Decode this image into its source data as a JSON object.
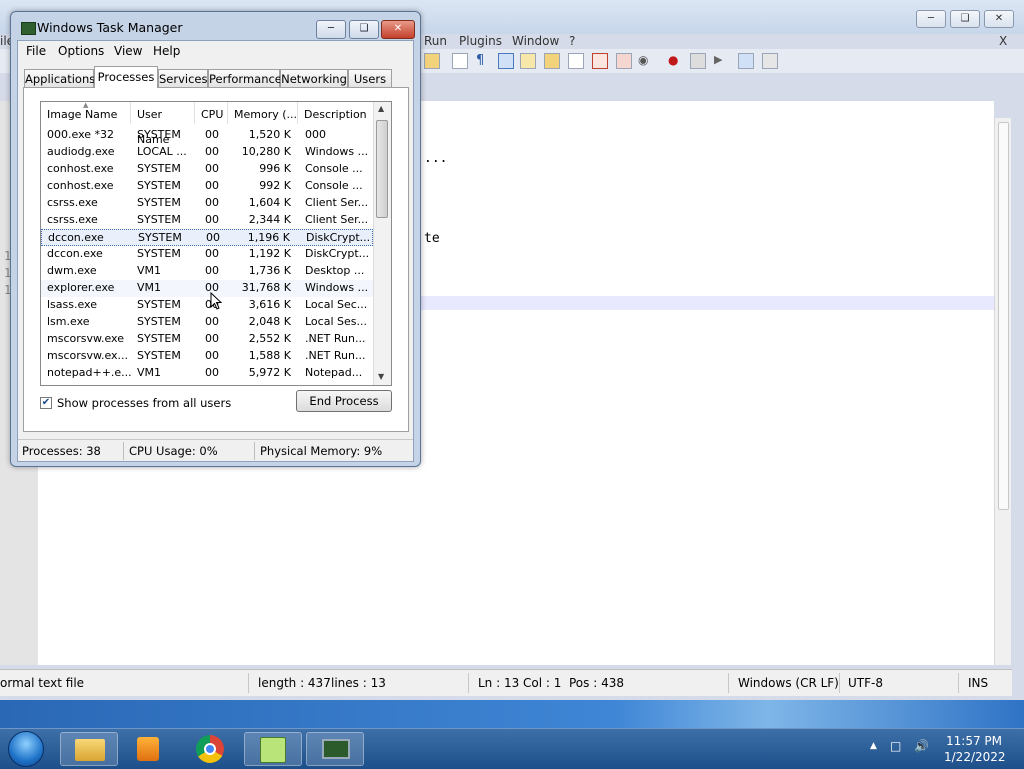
{
  "notepad": {
    "menu": [
      "ile",
      "Run",
      "Plugins",
      "Window",
      "?"
    ],
    "close_x": "X",
    "gutter_numbers": [
      "1",
      "1",
      "1"
    ],
    "code_fragments": [
      "...",
      "te"
    ],
    "status": {
      "type": "ormal text file",
      "length": "length : 437",
      "lines": "lines : 13",
      "ln": "Ln : 13",
      "col": "Col : 1",
      "pos": "Pos : 438",
      "eol": "Windows (CR LF)",
      "encoding": "UTF-8",
      "mode": "INS"
    }
  },
  "task_manager": {
    "title": "Windows Task Manager",
    "menu": [
      "File",
      "Options",
      "View",
      "Help"
    ],
    "tabs": [
      "Applications",
      "Processes",
      "Services",
      "Performance",
      "Networking",
      "Users"
    ],
    "active_tab": "Processes",
    "columns": [
      "Image Name",
      "User Name",
      "CPU",
      "Memory (...",
      "Description"
    ],
    "rows": [
      [
        "000.exe *32",
        "SYSTEM",
        "00",
        "1,520 K",
        "000"
      ],
      [
        "audiodg.exe",
        "LOCAL ...",
        "00",
        "10,280 K",
        "Windows ..."
      ],
      [
        "conhost.exe",
        "SYSTEM",
        "00",
        "996 K",
        "Console ..."
      ],
      [
        "conhost.exe",
        "SYSTEM",
        "00",
        "992 K",
        "Console ..."
      ],
      [
        "csrss.exe",
        "SYSTEM",
        "00",
        "1,604 K",
        "Client Ser..."
      ],
      [
        "csrss.exe",
        "SYSTEM",
        "00",
        "2,344 K",
        "Client Ser..."
      ],
      [
        "dccon.exe",
        "SYSTEM",
        "00",
        "1,196 K",
        "DiskCrypt..."
      ],
      [
        "dccon.exe",
        "SYSTEM",
        "00",
        "1,192 K",
        "DiskCrypt..."
      ],
      [
        "dwm.exe",
        "VM1",
        "00",
        "1,736 K",
        "Desktop ..."
      ],
      [
        "explorer.exe",
        "VM1",
        "00",
        "31,768 K",
        "Windows ..."
      ],
      [
        "lsass.exe",
        "SYSTEM",
        "00",
        "3,616 K",
        "Local Sec..."
      ],
      [
        "lsm.exe",
        "SYSTEM",
        "00",
        "2,048 K",
        "Local Ses..."
      ],
      [
        "mscorsvw.exe",
        "SYSTEM",
        "00",
        "2,552 K",
        ".NET Run..."
      ],
      [
        "mscorsvw.ex...",
        "SYSTEM",
        "00",
        "1,588 K",
        ".NET Run..."
      ],
      [
        "notepad++.e...",
        "VM1",
        "00",
        "5,972 K",
        "Notepad..."
      ]
    ],
    "selected_row": 6,
    "hovered_row": 9,
    "show_all_label": "Show processes from all users",
    "show_all_checked": true,
    "end_process_label": "End Process",
    "status": {
      "processes": "Processes: 38",
      "cpu": "CPU Usage: 0%",
      "memory": "Physical Memory: 9%"
    }
  },
  "taskbar": {
    "apps": [
      "start-orb",
      "explorer-icon",
      "media-player-icon",
      "chrome-icon",
      "notepadpp-icon",
      "task-manager-icon"
    ],
    "time": "11:57 PM",
    "date": "1/22/2022"
  },
  "colors": {
    "accent": "#3b6fb6",
    "selection": "#e9f0fb",
    "taskbar": "#1d4f8a",
    "close_button": "#c5452e"
  }
}
